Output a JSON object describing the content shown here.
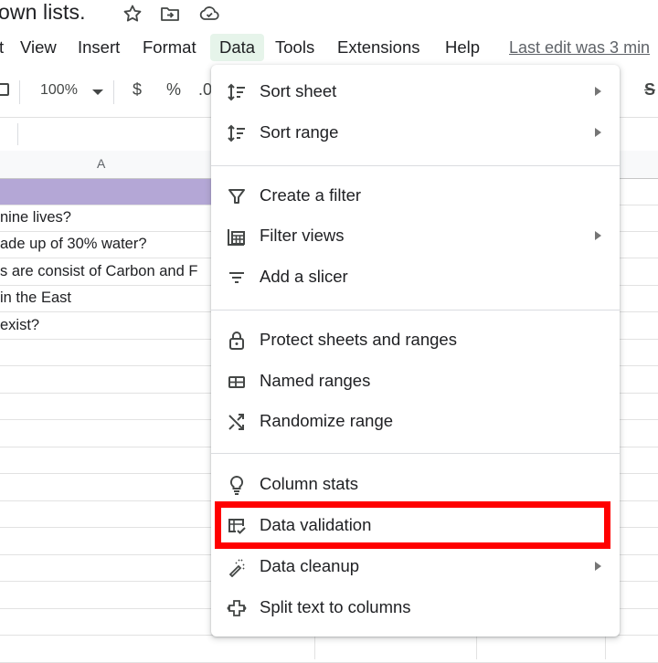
{
  "window": {
    "doc_title": "own lists.",
    "title_icons": [
      "star-icon",
      "move-to-folder-icon",
      "cloud-saved-icon"
    ]
  },
  "menu_bar": {
    "items": [
      {
        "label": "t",
        "active": false
      },
      {
        "label": "View",
        "active": false
      },
      {
        "label": "Insert",
        "active": false
      },
      {
        "label": "Format",
        "active": false
      },
      {
        "label": "Data",
        "active": true
      },
      {
        "label": "Tools",
        "active": false
      },
      {
        "label": "Extensions",
        "active": false
      },
      {
        "label": "Help",
        "active": false
      }
    ],
    "last_edit": "Last edit was 3 min"
  },
  "toolbar": {
    "zoom": "100%",
    "currency": "$",
    "percent": "%",
    "decimal": ".0",
    "strike_partial": "S"
  },
  "sheet": {
    "column_header": "A",
    "header_row_color": "#b4a7d6",
    "rows": [
      "",
      "nine lives?",
      "ade up of 30% water?",
      "s are consist of Carbon and F",
      "in the East",
      " exist?",
      "",
      "",
      "",
      "",
      "",
      "",
      "",
      "",
      "",
      "",
      "",
      "",
      ""
    ]
  },
  "data_menu": {
    "items": [
      {
        "label": "Sort sheet",
        "icon": "sort-icon",
        "submenu": true
      },
      {
        "label": "Sort range",
        "icon": "sort-icon",
        "submenu": true
      },
      {
        "label": "Create a filter",
        "icon": "filter-icon",
        "submenu": false
      },
      {
        "label": "Filter views",
        "icon": "filter-views-icon",
        "submenu": true
      },
      {
        "label": "Add a slicer",
        "icon": "slicer-icon",
        "submenu": false
      },
      {
        "label": "Protect sheets and ranges",
        "icon": "lock-icon",
        "submenu": false
      },
      {
        "label": "Named ranges",
        "icon": "named-ranges-icon",
        "submenu": false
      },
      {
        "label": "Randomize range",
        "icon": "shuffle-icon",
        "submenu": false
      },
      {
        "label": "Column stats",
        "icon": "lightbulb-icon",
        "submenu": false
      },
      {
        "label": "Data validation",
        "icon": "data-validation-icon",
        "submenu": false,
        "highlighted": true
      },
      {
        "label": "Data cleanup",
        "icon": "magic-wand-icon",
        "submenu": true
      },
      {
        "label": "Split text to columns",
        "icon": "split-columns-icon",
        "submenu": false
      }
    ],
    "highlight_color": "#ff0000"
  }
}
